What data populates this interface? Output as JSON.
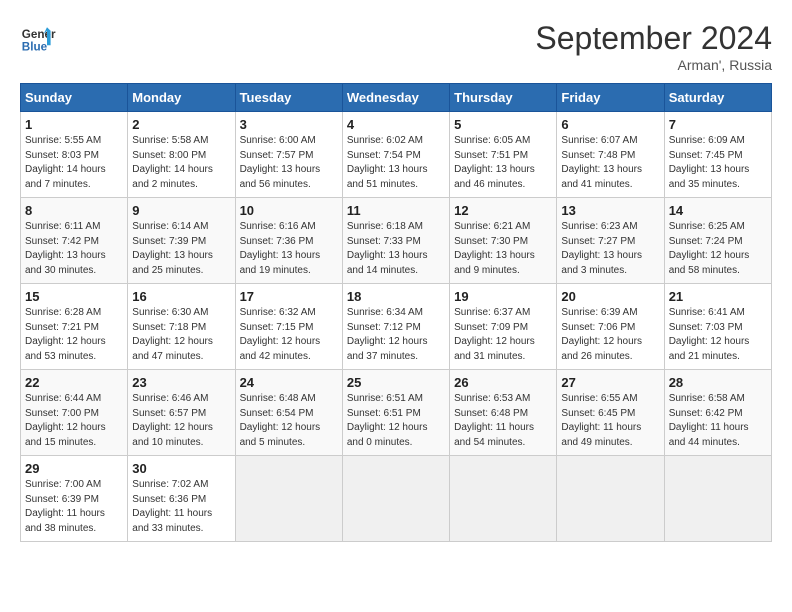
{
  "header": {
    "logo_line1": "General",
    "logo_line2": "Blue",
    "month_year": "September 2024",
    "location": "Arman', Russia"
  },
  "days_of_week": [
    "Sunday",
    "Monday",
    "Tuesday",
    "Wednesday",
    "Thursday",
    "Friday",
    "Saturday"
  ],
  "weeks": [
    [
      {
        "day": "1",
        "sunrise": "Sunrise: 5:55 AM",
        "sunset": "Sunset: 8:03 PM",
        "daylight": "Daylight: 14 hours and 7 minutes."
      },
      {
        "day": "2",
        "sunrise": "Sunrise: 5:58 AM",
        "sunset": "Sunset: 8:00 PM",
        "daylight": "Daylight: 14 hours and 2 minutes."
      },
      {
        "day": "3",
        "sunrise": "Sunrise: 6:00 AM",
        "sunset": "Sunset: 7:57 PM",
        "daylight": "Daylight: 13 hours and 56 minutes."
      },
      {
        "day": "4",
        "sunrise": "Sunrise: 6:02 AM",
        "sunset": "Sunset: 7:54 PM",
        "daylight": "Daylight: 13 hours and 51 minutes."
      },
      {
        "day": "5",
        "sunrise": "Sunrise: 6:05 AM",
        "sunset": "Sunset: 7:51 PM",
        "daylight": "Daylight: 13 hours and 46 minutes."
      },
      {
        "day": "6",
        "sunrise": "Sunrise: 6:07 AM",
        "sunset": "Sunset: 7:48 PM",
        "daylight": "Daylight: 13 hours and 41 minutes."
      },
      {
        "day": "7",
        "sunrise": "Sunrise: 6:09 AM",
        "sunset": "Sunset: 7:45 PM",
        "daylight": "Daylight: 13 hours and 35 minutes."
      }
    ],
    [
      {
        "day": "8",
        "sunrise": "Sunrise: 6:11 AM",
        "sunset": "Sunset: 7:42 PM",
        "daylight": "Daylight: 13 hours and 30 minutes."
      },
      {
        "day": "9",
        "sunrise": "Sunrise: 6:14 AM",
        "sunset": "Sunset: 7:39 PM",
        "daylight": "Daylight: 13 hours and 25 minutes."
      },
      {
        "day": "10",
        "sunrise": "Sunrise: 6:16 AM",
        "sunset": "Sunset: 7:36 PM",
        "daylight": "Daylight: 13 hours and 19 minutes."
      },
      {
        "day": "11",
        "sunrise": "Sunrise: 6:18 AM",
        "sunset": "Sunset: 7:33 PM",
        "daylight": "Daylight: 13 hours and 14 minutes."
      },
      {
        "day": "12",
        "sunrise": "Sunrise: 6:21 AM",
        "sunset": "Sunset: 7:30 PM",
        "daylight": "Daylight: 13 hours and 9 minutes."
      },
      {
        "day": "13",
        "sunrise": "Sunrise: 6:23 AM",
        "sunset": "Sunset: 7:27 PM",
        "daylight": "Daylight: 13 hours and 3 minutes."
      },
      {
        "day": "14",
        "sunrise": "Sunrise: 6:25 AM",
        "sunset": "Sunset: 7:24 PM",
        "daylight": "Daylight: 12 hours and 58 minutes."
      }
    ],
    [
      {
        "day": "15",
        "sunrise": "Sunrise: 6:28 AM",
        "sunset": "Sunset: 7:21 PM",
        "daylight": "Daylight: 12 hours and 53 minutes."
      },
      {
        "day": "16",
        "sunrise": "Sunrise: 6:30 AM",
        "sunset": "Sunset: 7:18 PM",
        "daylight": "Daylight: 12 hours and 47 minutes."
      },
      {
        "day": "17",
        "sunrise": "Sunrise: 6:32 AM",
        "sunset": "Sunset: 7:15 PM",
        "daylight": "Daylight: 12 hours and 42 minutes."
      },
      {
        "day": "18",
        "sunrise": "Sunrise: 6:34 AM",
        "sunset": "Sunset: 7:12 PM",
        "daylight": "Daylight: 12 hours and 37 minutes."
      },
      {
        "day": "19",
        "sunrise": "Sunrise: 6:37 AM",
        "sunset": "Sunset: 7:09 PM",
        "daylight": "Daylight: 12 hours and 31 minutes."
      },
      {
        "day": "20",
        "sunrise": "Sunrise: 6:39 AM",
        "sunset": "Sunset: 7:06 PM",
        "daylight": "Daylight: 12 hours and 26 minutes."
      },
      {
        "day": "21",
        "sunrise": "Sunrise: 6:41 AM",
        "sunset": "Sunset: 7:03 PM",
        "daylight": "Daylight: 12 hours and 21 minutes."
      }
    ],
    [
      {
        "day": "22",
        "sunrise": "Sunrise: 6:44 AM",
        "sunset": "Sunset: 7:00 PM",
        "daylight": "Daylight: 12 hours and 15 minutes."
      },
      {
        "day": "23",
        "sunrise": "Sunrise: 6:46 AM",
        "sunset": "Sunset: 6:57 PM",
        "daylight": "Daylight: 12 hours and 10 minutes."
      },
      {
        "day": "24",
        "sunrise": "Sunrise: 6:48 AM",
        "sunset": "Sunset: 6:54 PM",
        "daylight": "Daylight: 12 hours and 5 minutes."
      },
      {
        "day": "25",
        "sunrise": "Sunrise: 6:51 AM",
        "sunset": "Sunset: 6:51 PM",
        "daylight": "Daylight: 12 hours and 0 minutes."
      },
      {
        "day": "26",
        "sunrise": "Sunrise: 6:53 AM",
        "sunset": "Sunset: 6:48 PM",
        "daylight": "Daylight: 11 hours and 54 minutes."
      },
      {
        "day": "27",
        "sunrise": "Sunrise: 6:55 AM",
        "sunset": "Sunset: 6:45 PM",
        "daylight": "Daylight: 11 hours and 49 minutes."
      },
      {
        "day": "28",
        "sunrise": "Sunrise: 6:58 AM",
        "sunset": "Sunset: 6:42 PM",
        "daylight": "Daylight: 11 hours and 44 minutes."
      }
    ],
    [
      {
        "day": "29",
        "sunrise": "Sunrise: 7:00 AM",
        "sunset": "Sunset: 6:39 PM",
        "daylight": "Daylight: 11 hours and 38 minutes."
      },
      {
        "day": "30",
        "sunrise": "Sunrise: 7:02 AM",
        "sunset": "Sunset: 6:36 PM",
        "daylight": "Daylight: 11 hours and 33 minutes."
      },
      null,
      null,
      null,
      null,
      null
    ]
  ]
}
